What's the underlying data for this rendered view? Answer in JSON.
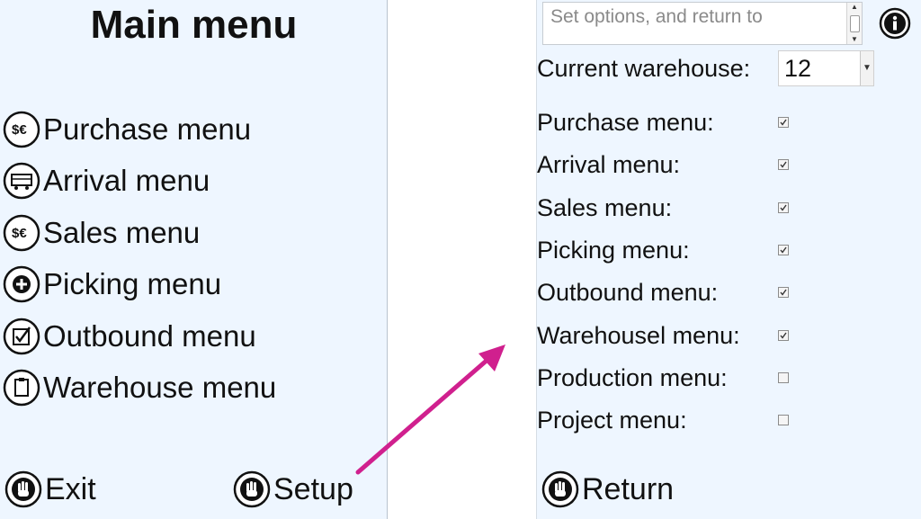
{
  "main_menu": {
    "title": "Main menu",
    "items": [
      {
        "label": "Purchase menu",
        "icon": "currency-exchange-icon"
      },
      {
        "label": "Arrival menu",
        "icon": "truck-icon"
      },
      {
        "label": "Sales menu",
        "icon": "currency-exchange-icon"
      },
      {
        "label": "Picking menu",
        "icon": "plus-circle-icon"
      },
      {
        "label": "Outbound menu",
        "icon": "checklist-icon"
      },
      {
        "label": "Warehouse menu",
        "icon": "clipboard-icon"
      }
    ],
    "exit_label": "Exit",
    "setup_label": "Setup",
    "hand_icon": "hand-stop-icon"
  },
  "setup": {
    "notes_placeholder": "Set options, and return to",
    "info_icon": "info-icon",
    "warehouse_label": "Current warehouse:",
    "warehouse_value": "12",
    "options": [
      {
        "label": "Purchase menu:",
        "checked": true
      },
      {
        "label": "Arrival menu:",
        "checked": true
      },
      {
        "label": "Sales menu:",
        "checked": true
      },
      {
        "label": "Picking menu:",
        "checked": true
      },
      {
        "label": "Outbound menu:",
        "checked": true
      },
      {
        "label": "Warehousel menu:",
        "checked": true
      },
      {
        "label": "Production menu:",
        "checked": false
      },
      {
        "label": "Project menu:",
        "checked": false
      }
    ],
    "return_label": "Return"
  },
  "colors": {
    "panel_bg": "#eef6ff",
    "arrow": "#d0208e"
  }
}
